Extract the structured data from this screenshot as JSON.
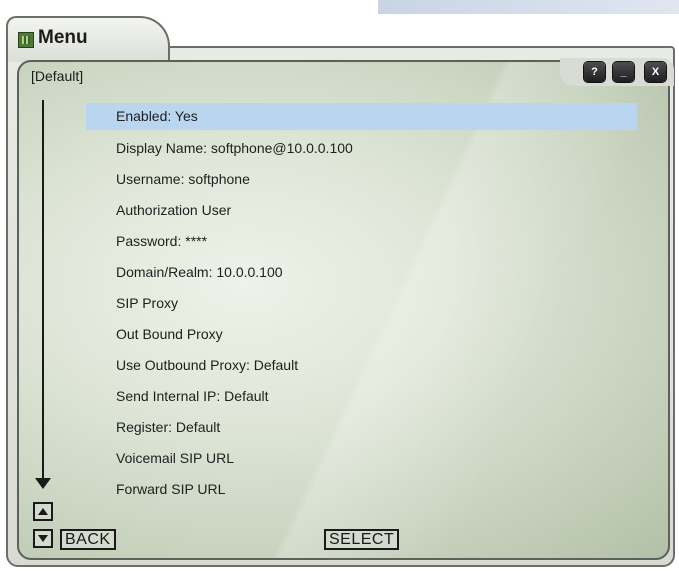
{
  "window": {
    "title": "Menu",
    "header_label": "[Default]",
    "controls": {
      "help": "?",
      "minimize": "_",
      "close": "X"
    }
  },
  "menu": {
    "items": [
      {
        "label": "Enabled: Yes",
        "selected": true
      },
      {
        "label": "Display Name: softphone@10.0.0.100"
      },
      {
        "label": "Username: softphone"
      },
      {
        "label": "Authorization User"
      },
      {
        "label": "Password: ****"
      },
      {
        "label": "Domain/Realm: 10.0.0.100"
      },
      {
        "label": "SIP Proxy"
      },
      {
        "label": "Out Bound Proxy"
      },
      {
        "label": "Use Outbound Proxy: Default"
      },
      {
        "label": "Send Internal IP: Default"
      },
      {
        "label": "Register: Default"
      },
      {
        "label": "Voicemail SIP URL"
      },
      {
        "label": "Forward SIP URL"
      }
    ]
  },
  "footer": {
    "back_label": "BACK",
    "select_label": "SELECT"
  },
  "colors": {
    "selection": "#b9d5ef",
    "panel": "#dfe6d8",
    "border": "#5e615a"
  },
  "icons": [
    "app-icon",
    "up-arrow-icon",
    "down-arrow-icon",
    "scroll-arrow-icon"
  ]
}
